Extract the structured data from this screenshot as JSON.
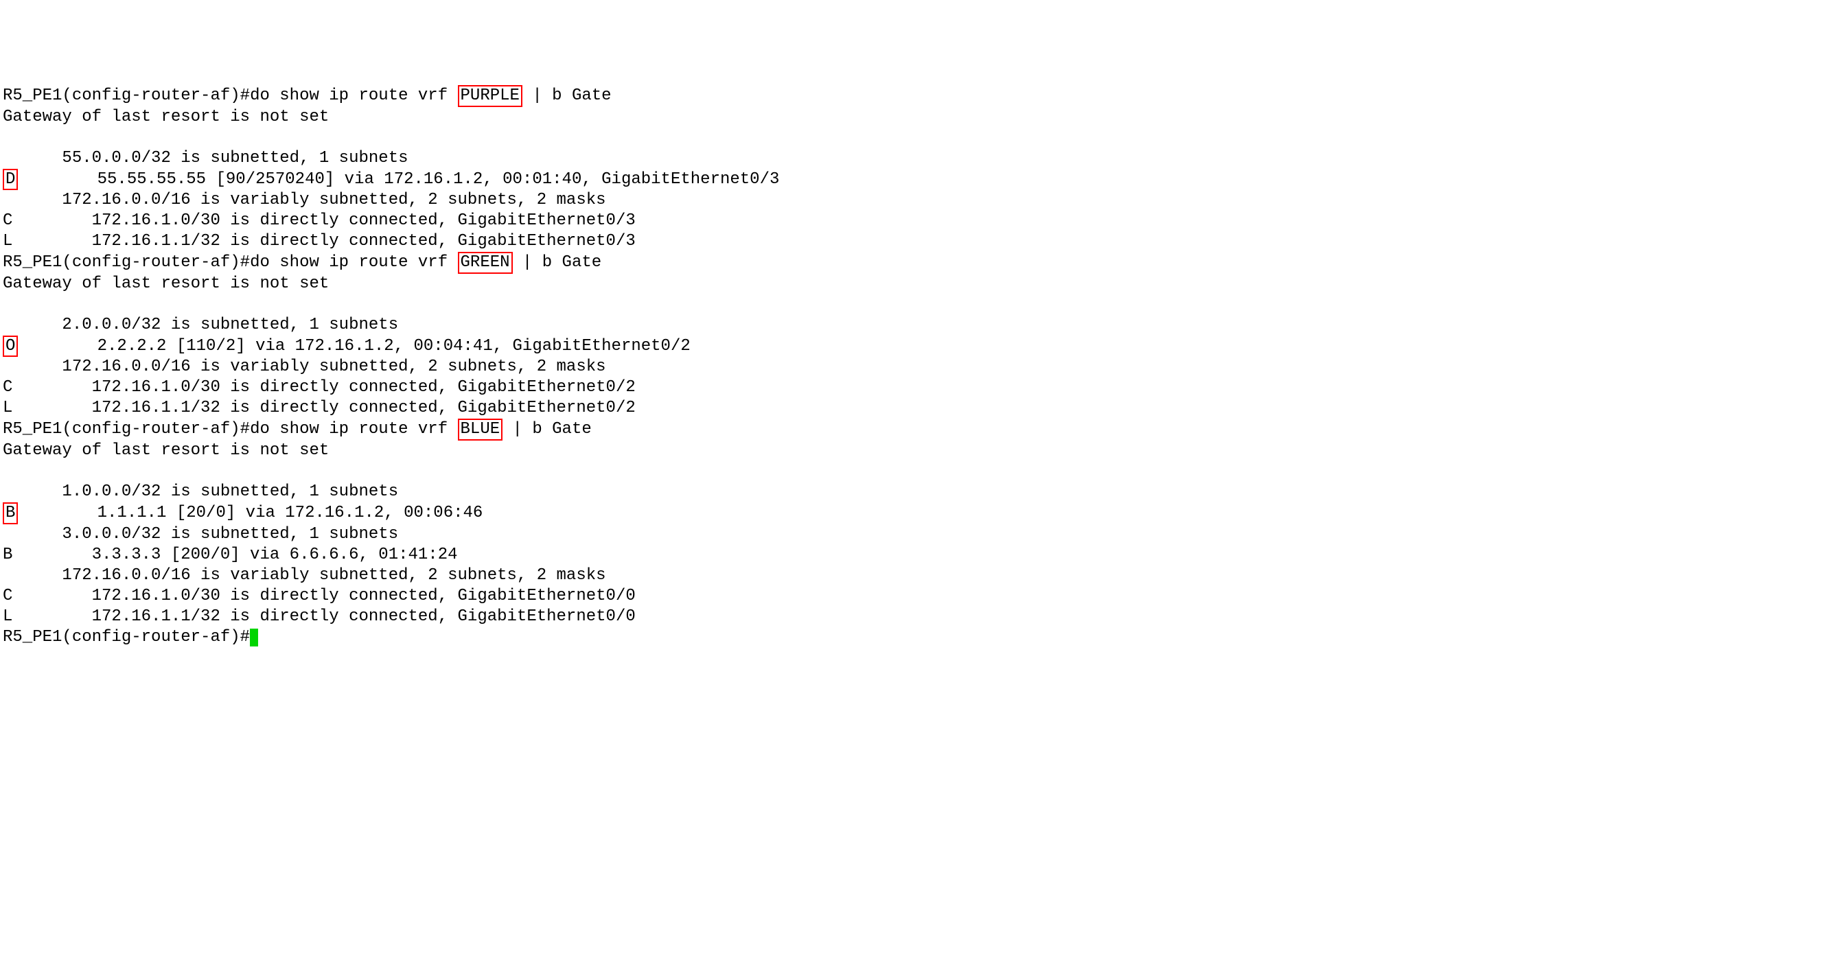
{
  "terminal": {
    "purple": {
      "prompt": "R5_PE1(config-router-af)#",
      "cmd_pre": "do show ip route vrf ",
      "vrf": "PURPLE",
      "cmd_post": " | b Gate",
      "gateway": "Gateway of last resort is not set",
      "l1": "      55.0.0.0/32 is subnetted, 1 subnets",
      "code_d": "D",
      "l2": "        55.55.55.55 [90/2570240] via 172.16.1.2, 00:01:40, GigabitEthernet0/3",
      "l3": "      172.16.0.0/16 is variably subnetted, 2 subnets, 2 masks",
      "l4": "C        172.16.1.0/30 is directly connected, GigabitEthernet0/3",
      "l5": "L        172.16.1.1/32 is directly connected, GigabitEthernet0/3"
    },
    "green": {
      "prompt": "R5_PE1(config-router-af)#",
      "cmd_pre": "do show ip route vrf ",
      "vrf": "GREEN",
      "cmd_post": " | b Gate",
      "gateway": "Gateway of last resort is not set",
      "l1": "      2.0.0.0/32 is subnetted, 1 subnets",
      "code_o": "O",
      "l2": "        2.2.2.2 [110/2] via 172.16.1.2, 00:04:41, GigabitEthernet0/2",
      "l3": "      172.16.0.0/16 is variably subnetted, 2 subnets, 2 masks",
      "l4": "C        172.16.1.0/30 is directly connected, GigabitEthernet0/2",
      "l5": "L        172.16.1.1/32 is directly connected, GigabitEthernet0/2"
    },
    "blue": {
      "prompt": "R5_PE1(config-router-af)#",
      "cmd_pre": "do show ip route vrf ",
      "vrf": "BLUE",
      "cmd_post": " | b Gate",
      "gateway": "Gateway of last resort is not set",
      "l1": "      1.0.0.0/32 is subnetted, 1 subnets",
      "code_b": "B",
      "l2": "        1.1.1.1 [20/0] via 172.16.1.2, 00:06:46",
      "l3": "      3.0.0.0/32 is subnetted, 1 subnets",
      "l4": "B        3.3.3.3 [200/0] via 6.6.6.6, 01:41:24",
      "l5": "      172.16.0.0/16 is variably subnetted, 2 subnets, 2 masks",
      "l6": "C        172.16.1.0/30 is directly connected, GigabitEthernet0/0",
      "l7": "L        172.16.1.1/32 is directly connected, GigabitEthernet0/0"
    },
    "final_prompt": "R5_PE1(config-router-af)#"
  }
}
